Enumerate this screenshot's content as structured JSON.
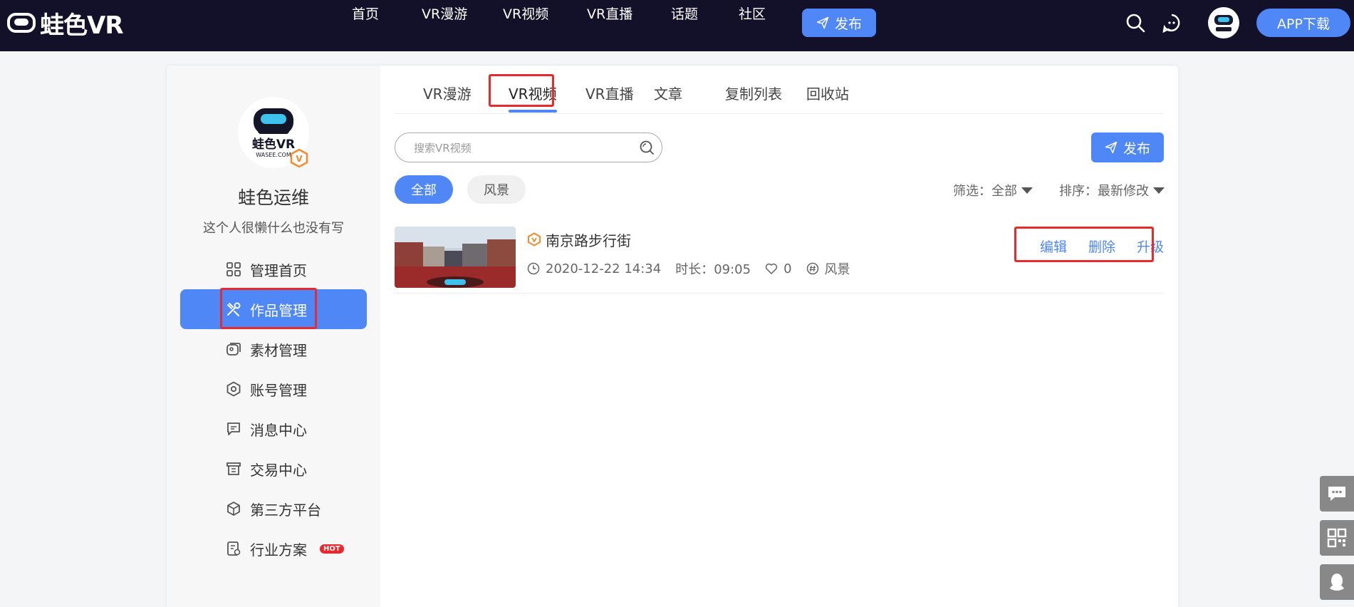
{
  "topbar": {
    "logo_text": "蛙色VR",
    "nav": [
      "首页",
      "VR漫游",
      "VR视频",
      "VR直播",
      "话题",
      "社区"
    ],
    "publish_label": "发布",
    "app_download_label": "APP下载",
    "brand_color": "#4f87f6"
  },
  "profile": {
    "avatar_text": "蛙色VR",
    "avatar_sub": "WASEE.COM",
    "name": "蛙色运维",
    "bio": "这个人很懒什么也没有写"
  },
  "sidebar": {
    "items": [
      {
        "label": "管理首页",
        "icon": "grid-icon"
      },
      {
        "label": "作品管理",
        "icon": "tools-icon"
      },
      {
        "label": "素材管理",
        "icon": "material-icon"
      },
      {
        "label": "账号管理",
        "icon": "gear-icon"
      },
      {
        "label": "消息中心",
        "icon": "message-icon"
      },
      {
        "label": "交易中心",
        "icon": "store-icon"
      },
      {
        "label": "第三方平台",
        "icon": "cube-icon"
      },
      {
        "label": "行业方案",
        "icon": "document-icon"
      }
    ],
    "hot_badge": "HOT",
    "active_index": 1
  },
  "tabs": {
    "items": [
      "VR漫游",
      "VR视频",
      "VR直播",
      "文章",
      "复制列表",
      "回收站"
    ],
    "active_index": 1
  },
  "search": {
    "placeholder": "搜索VR视频"
  },
  "publish_label": "发布",
  "chips": [
    "全部",
    "风景"
  ],
  "filter": {
    "filter_label": "筛选：全部",
    "sort_label": "排序：最新修改"
  },
  "videos": [
    {
      "title": "南京路步行街",
      "date": "2020-12-22 14:34",
      "duration": "时长：09:05",
      "likes": "0",
      "tag": "风景",
      "actions": [
        "编辑",
        "删除",
        "升级"
      ]
    }
  ]
}
